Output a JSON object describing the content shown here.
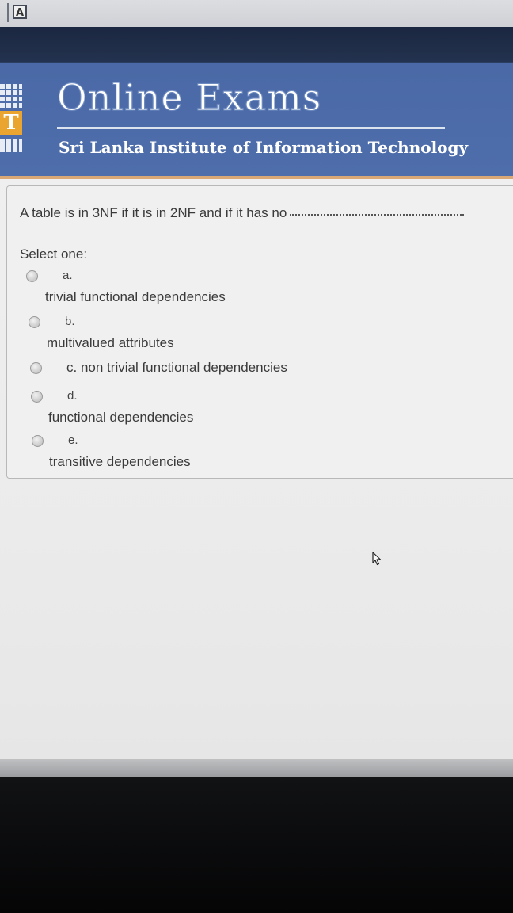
{
  "header": {
    "title": "Online Exams",
    "subtitle": "Sri Lanka Institute of Information Technology",
    "logo_letter": "T"
  },
  "top_bar": {
    "badge_letter": "A"
  },
  "question": {
    "text": "A table is in 3NF if it is in 2NF and if it has no",
    "select_label": "Select one:",
    "options": [
      {
        "letter": "a.",
        "text": "trivial functional dependencies"
      },
      {
        "letter": "b.",
        "text": "multivalued attributes"
      },
      {
        "letter": "c.",
        "text": "non trivial functional dependencies"
      },
      {
        "letter": "d.",
        "text": "functional dependencies"
      },
      {
        "letter": "e.",
        "text": "transitive dependencies"
      }
    ]
  },
  "icons": {
    "radio": "radio-button-icon",
    "cursor": "mouse-pointer-icon",
    "logo": "sliit-logo-icon"
  },
  "colors": {
    "header_bg": "#4e6dab",
    "dark_band": "#1b2740",
    "accent_orange": "#e9a530",
    "content_bg": "#efefef"
  }
}
